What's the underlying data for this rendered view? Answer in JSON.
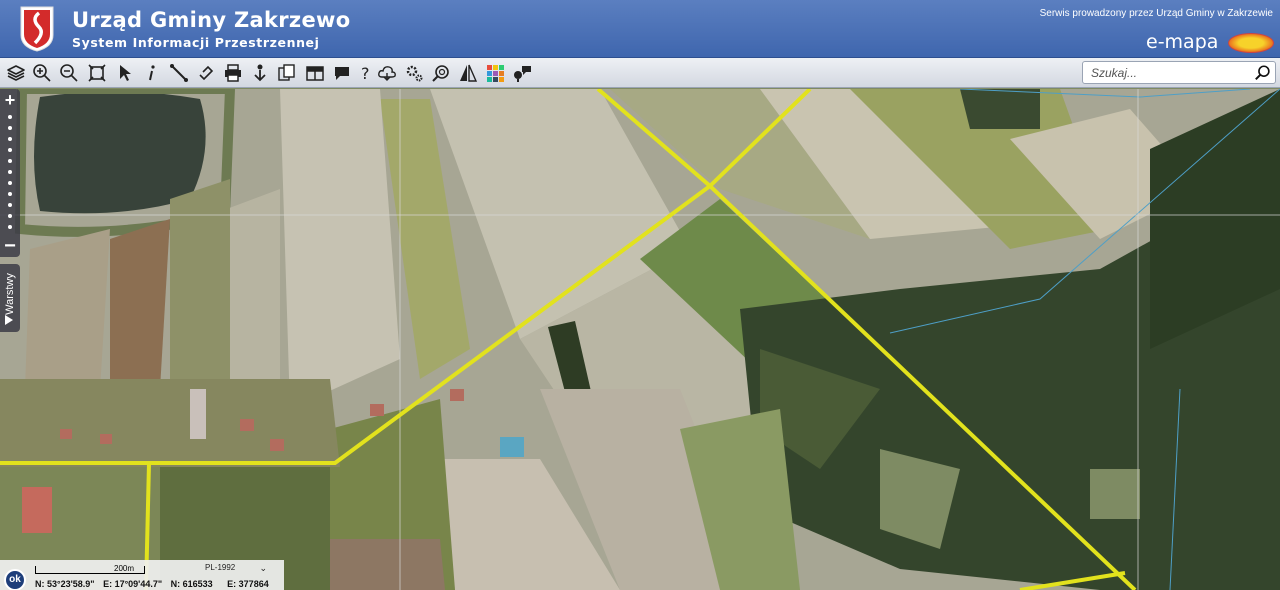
{
  "header": {
    "title": "Urząd Gminy Zakrzewo",
    "subtitle": "System Informacji Przestrzennej",
    "operator_note": "Serwis prowadzony przez Urząd Gminy w Zakrzewie",
    "brand": "e-mapa",
    "colors": {
      "header_top": "#5b7fc0",
      "header_bottom": "#3f66ae"
    }
  },
  "toolbar": {
    "tools": [
      "layers-icon",
      "zoom-in-icon",
      "zoom-out-icon",
      "zoom-extent-icon",
      "select-arrow-icon",
      "info-icon",
      "measure-icon",
      "link-icon",
      "print-icon",
      "download-icon",
      "copy-icon",
      "table-icon",
      "bubble-icon",
      "help-icon",
      "cloud-icon",
      "settings-icon",
      "zoom-search-icon",
      "split-compare-icon",
      "color-grid-icon",
      "pin-comment-icon"
    ],
    "search_placeholder": "Szukaj..."
  },
  "map": {
    "zoom_in": "+",
    "zoom_out": "−",
    "layers_tab": "Warstwy",
    "road_color": "#e2e21d",
    "scale": "200m",
    "crs": "PL-1992",
    "ok_label": "ok",
    "coords": {
      "lat": "N: 53°23'58.9\"",
      "lon": "E: 17°09'44.7\"",
      "northing": "N: 616533",
      "easting": "E: 377864"
    }
  }
}
